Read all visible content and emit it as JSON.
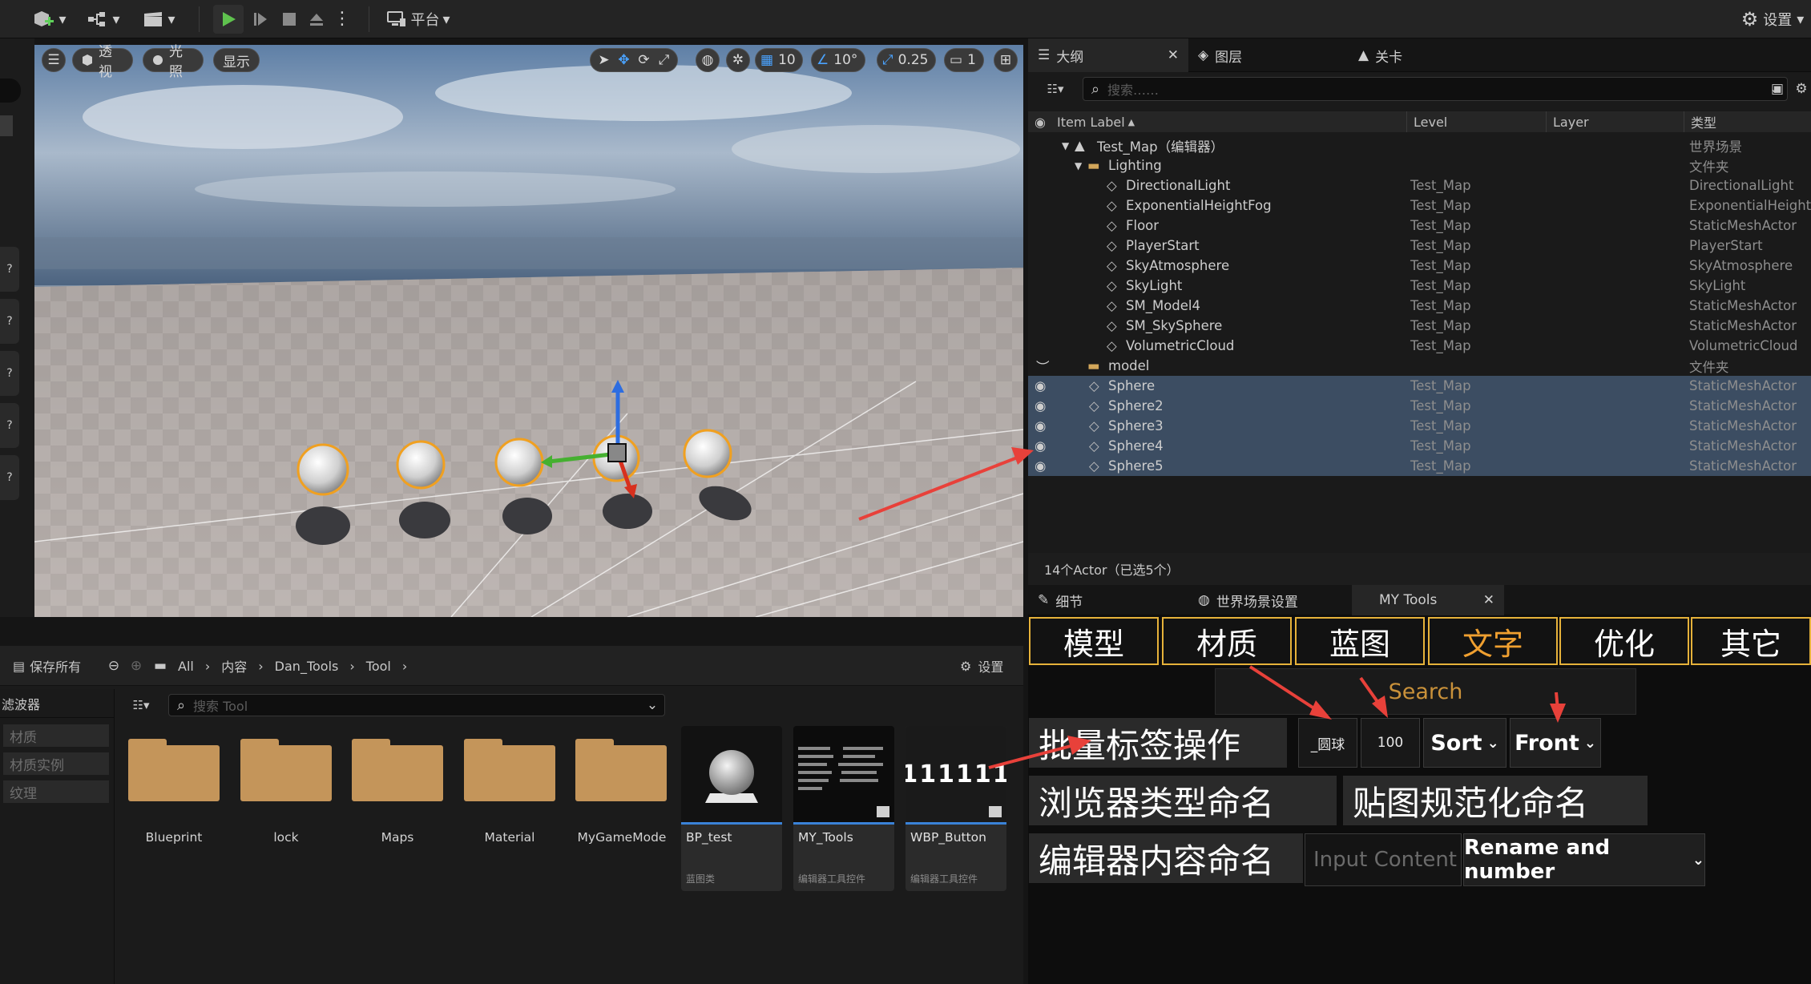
{
  "toolbar": {
    "platform_label": "平台",
    "settings_label": "设置"
  },
  "viewport": {
    "perspective_label": "透视",
    "lit_label": "光照",
    "show_label": "显示",
    "grid_snap": "10",
    "rotate_snap": "10°",
    "scale_snap": "0.25",
    "camera_speed": "1"
  },
  "outliner": {
    "tabs": [
      {
        "label": "大纲"
      },
      {
        "label": "图层"
      },
      {
        "label": "关卡"
      }
    ],
    "search_placeholder": "搜索……",
    "columns": {
      "label": "Item Label",
      "level": "Level",
      "layer": "Layer",
      "type": "类型"
    },
    "root": {
      "label": "Test_Map（编辑器）",
      "type": "世界场景"
    },
    "lighting_folder": {
      "label": "Lighting",
      "type": "文件夹"
    },
    "lighting_items": [
      {
        "label": "DirectionalLight",
        "level": "Test_Map",
        "type": "DirectionalLight"
      },
      {
        "label": "ExponentialHeightFog",
        "level": "Test_Map",
        "type": "ExponentialHeightF"
      },
      {
        "label": "Floor",
        "level": "Test_Map",
        "type": "StaticMeshActor"
      },
      {
        "label": "PlayerStart",
        "level": "Test_Map",
        "type": "PlayerStart"
      },
      {
        "label": "SkyAtmosphere",
        "level": "Test_Map",
        "type": "SkyAtmosphere"
      },
      {
        "label": "SkyLight",
        "level": "Test_Map",
        "type": "SkyLight"
      },
      {
        "label": "SM_Model4",
        "level": "Test_Map",
        "type": "StaticMeshActor"
      },
      {
        "label": "SM_SkySphere",
        "level": "Test_Map",
        "type": "StaticMeshActor"
      },
      {
        "label": "VolumetricCloud",
        "level": "Test_Map",
        "type": "VolumetricCloud"
      }
    ],
    "model_folder": {
      "label": "model",
      "type": "文件夹"
    },
    "model_items": [
      {
        "label": "Sphere",
        "level": "Test_Map",
        "type": "StaticMeshActor"
      },
      {
        "label": "Sphere2",
        "level": "Test_Map",
        "type": "StaticMeshActor"
      },
      {
        "label": "Sphere3",
        "level": "Test_Map",
        "type": "StaticMeshActor"
      },
      {
        "label": "Sphere4",
        "level": "Test_Map",
        "type": "StaticMeshActor"
      },
      {
        "label": "Sphere5",
        "level": "Test_Map",
        "type": "StaticMeshActor"
      }
    ],
    "status": "14个Actor（已选5个）"
  },
  "details": {
    "tabs": [
      {
        "label": "细节"
      },
      {
        "label": "世界场景设置"
      },
      {
        "label": "MY Tools"
      }
    ]
  },
  "mytools": {
    "categories": [
      "模型",
      "材质",
      "蓝图",
      "文字",
      "优化",
      "其它"
    ],
    "search_placeholder": "Search",
    "batch_label_button": "批量标签操作",
    "prefix_value": "_圆球",
    "number_value": "100",
    "sort_label": "Sort",
    "front_label": "Front",
    "browser_type_naming_button": "浏览器类型命名",
    "texture_naming_button": "贴图规范化命名",
    "editor_content_naming_button": "编辑器内容命名",
    "input_placeholder": "Input Content",
    "rename_label": "Rename and number"
  },
  "content_browser": {
    "save_all_label": "保存所有",
    "breadcrumb": [
      "All",
      "内容",
      "Dan_Tools",
      "Tool"
    ],
    "settings_label": "设置",
    "filter_label": "滤波器",
    "filters": [
      "材质",
      "材质实例",
      "纹理"
    ],
    "search_placeholder": "搜索 Tool",
    "folders": [
      "Blueprint",
      "lock",
      "Maps",
      "Material",
      "MyGameMode"
    ],
    "assets": [
      {
        "name": "BP_test",
        "type": "蓝图类"
      },
      {
        "name": "MY_Tools",
        "type": "编辑器工具控件"
      },
      {
        "name": "WBP_Button",
        "type": "编辑器工具控件"
      }
    ],
    "button_thumb_text": "111111"
  },
  "colors": {
    "accent_orange": "#f0a030",
    "border_gold": "#e6b23a",
    "selection": "#3c4d62",
    "arrow_red": "#e8413a"
  }
}
